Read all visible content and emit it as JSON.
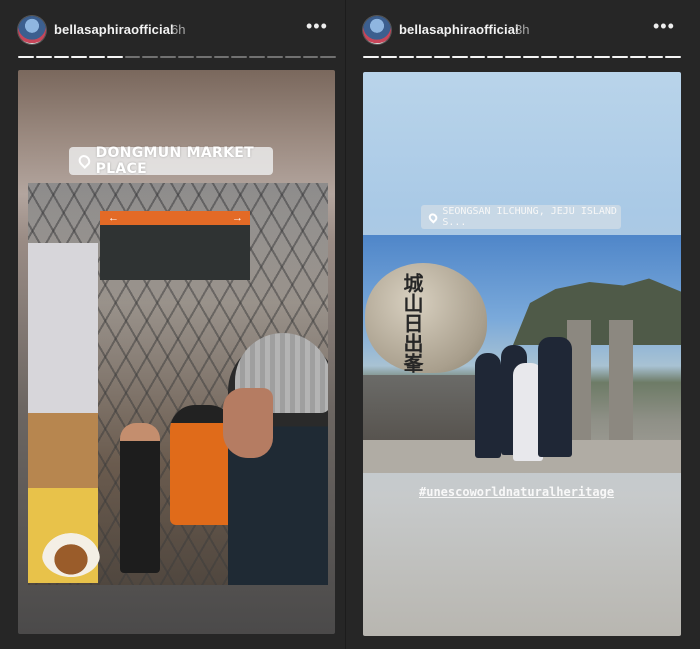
{
  "stories": [
    {
      "username": "bellasaphiraofficial",
      "timestamp": "6h",
      "more_icon": "more-horizontal-icon",
      "progress": {
        "segments": 18,
        "filled": 6
      },
      "location": "DONGMUN MARKET PLACE",
      "stickers": [
        "cake-sticker"
      ]
    },
    {
      "username": "bellasaphiraofficial",
      "timestamp": "3h",
      "more_icon": "more-horizontal-icon",
      "progress": {
        "segments": 18,
        "filled": 18
      },
      "location": "SEONGSAN ILCHUNG, JEJU ISLAND S...",
      "stone_text": "城山日出峯",
      "hashtag": "#unescoworldnaturalheritage"
    }
  ],
  "colors": {
    "background": "#262626",
    "text": "#f2f2f2",
    "timestamp": "#a8a8a8"
  }
}
